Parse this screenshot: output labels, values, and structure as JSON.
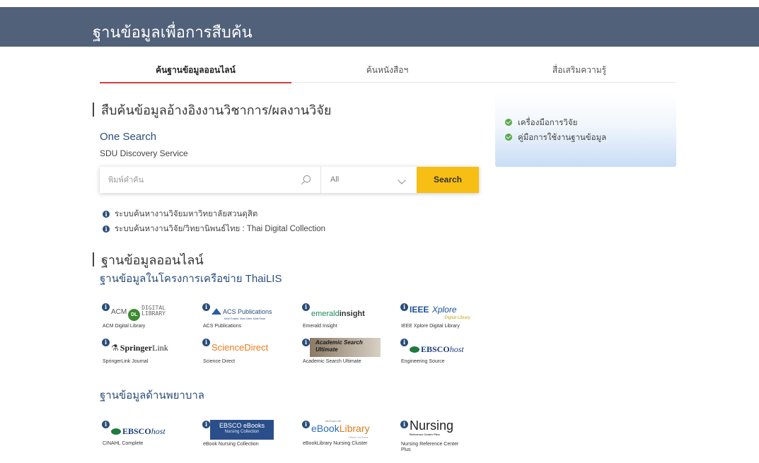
{
  "header": {
    "title": "ฐานข้อมูลเพื่อการสืบค้น"
  },
  "tabs": [
    {
      "label": "ค้นฐานข้อมูลออนไลน์",
      "active": true
    },
    {
      "label": "ค้นหนังสือฯ",
      "active": false
    },
    {
      "label": "สื่อเสริมความรู้",
      "active": false
    }
  ],
  "research": {
    "heading": "สืบค้นข้อมูลอ้างอิงงานวิชาการ/ผลงานวิจัย",
    "one_search": "One Search",
    "service": "SDU Discovery Service",
    "search": {
      "placeholder": "พิมพ์คำค้น",
      "filter_value": "All",
      "button_label": "Search"
    },
    "links": [
      "ระบบค้นหางานวิจัยมหาวิทยาลัยสวนดุสิต",
      "ระบบค้นหางานวิจัย/วิทยานิพนธ์ไทย : Thai Digital Collection"
    ]
  },
  "online_db": {
    "heading": "ฐานข้อมูลออนไลน์",
    "thailis_heading": "ฐานข้อมูลในโครงการเครือข่าย ThaiLIS",
    "thailis": [
      {
        "logo_a": "ACM",
        "logo_dl": "DL",
        "logo_b": "DIGITAL",
        "logo_c": "LIBRARY",
        "caption": "ACM Digital Library"
      },
      {
        "logo_a": "ACS Publications",
        "logo_b": "Most Trusted. Most Cited. Most Read.",
        "caption": "ACS Publications"
      },
      {
        "logo_a": "emerald",
        "logo_b": "insight",
        "caption": "Emerald Insight"
      },
      {
        "logo_a": "IEEE",
        "logo_b": "Xplore",
        "logo_c": "Digital Library",
        "caption": "IEEE Xplore Digital Library"
      },
      {
        "logo_a": "Springer",
        "logo_b": "Link",
        "caption": "SpringerLink Journal"
      },
      {
        "logo_a": "ScienceDirect",
        "caption": "Science Direct"
      },
      {
        "logo_a": "Academic Search",
        "logo_b": "Ultimate",
        "caption": "Academic Search Ultimate"
      },
      {
        "logo_a": "EBSCO",
        "logo_b": "host",
        "caption": "Engineering Source"
      }
    ],
    "nursing_heading": "ฐานข้อมูลด้านพยาบาล",
    "nursing": [
      {
        "logo_a": "EBSCO",
        "logo_b": "host",
        "caption": "CINAHL Complete"
      },
      {
        "logo_a": "EBSCO eBooks",
        "logo_b": "Nursing Collection",
        "caption": "eBook Nursing Collection"
      },
      {
        "logo_a": "McGraw-Hill",
        "logo_b": "eBook",
        "logo_c": "Library",
        "logo_d": "Check Out Now",
        "caption": "eBookLibrary Nursing Cluster"
      },
      {
        "logo_a": "Nursing",
        "logo_b": "Reference Center Plus",
        "caption": "Nursing Reference Center",
        "caption2": "Plus"
      }
    ]
  },
  "side_panel": {
    "links": [
      "เครื่องมือการวิจัย",
      "คู่มือการใช้งานฐานข้อมูล"
    ]
  },
  "colors": {
    "header_bg": "#51617a",
    "accent_blue": "#2a4e7a",
    "search_button": "#f7be13",
    "active_tab_underline": "#d23c3c",
    "check_green": "#5aa84a"
  },
  "icons": [
    "search-icon",
    "chevron-down-icon",
    "info-icon",
    "check-circle-icon"
  ]
}
